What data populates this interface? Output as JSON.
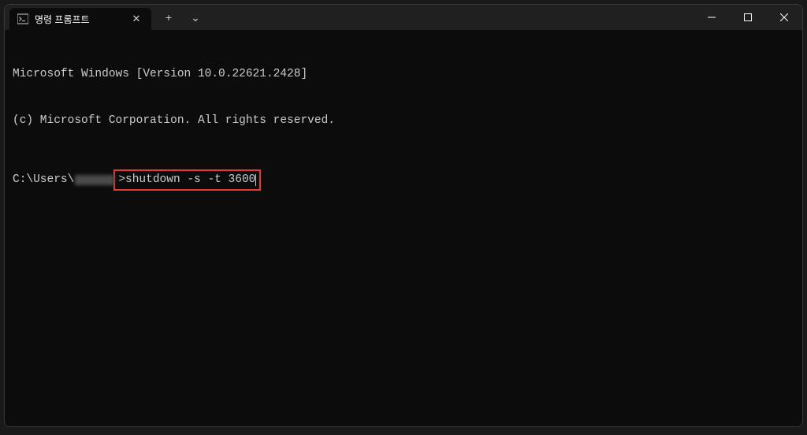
{
  "titlebar": {
    "tab_title": "명령 프롬프트",
    "tab_close": "✕",
    "new_tab": "+",
    "dropdown": "⌄"
  },
  "window_controls": {
    "minimize": "—",
    "maximize": "▢",
    "close": "✕"
  },
  "terminal": {
    "line1": "Microsoft Windows [Version 10.0.22621.2428]",
    "line2": "(c) Microsoft Corporation. All rights reserved.",
    "prompt_prefix": "C:\\Users\\",
    "prompt_suffix": ">",
    "command": "shutdown -s -t 3600"
  }
}
